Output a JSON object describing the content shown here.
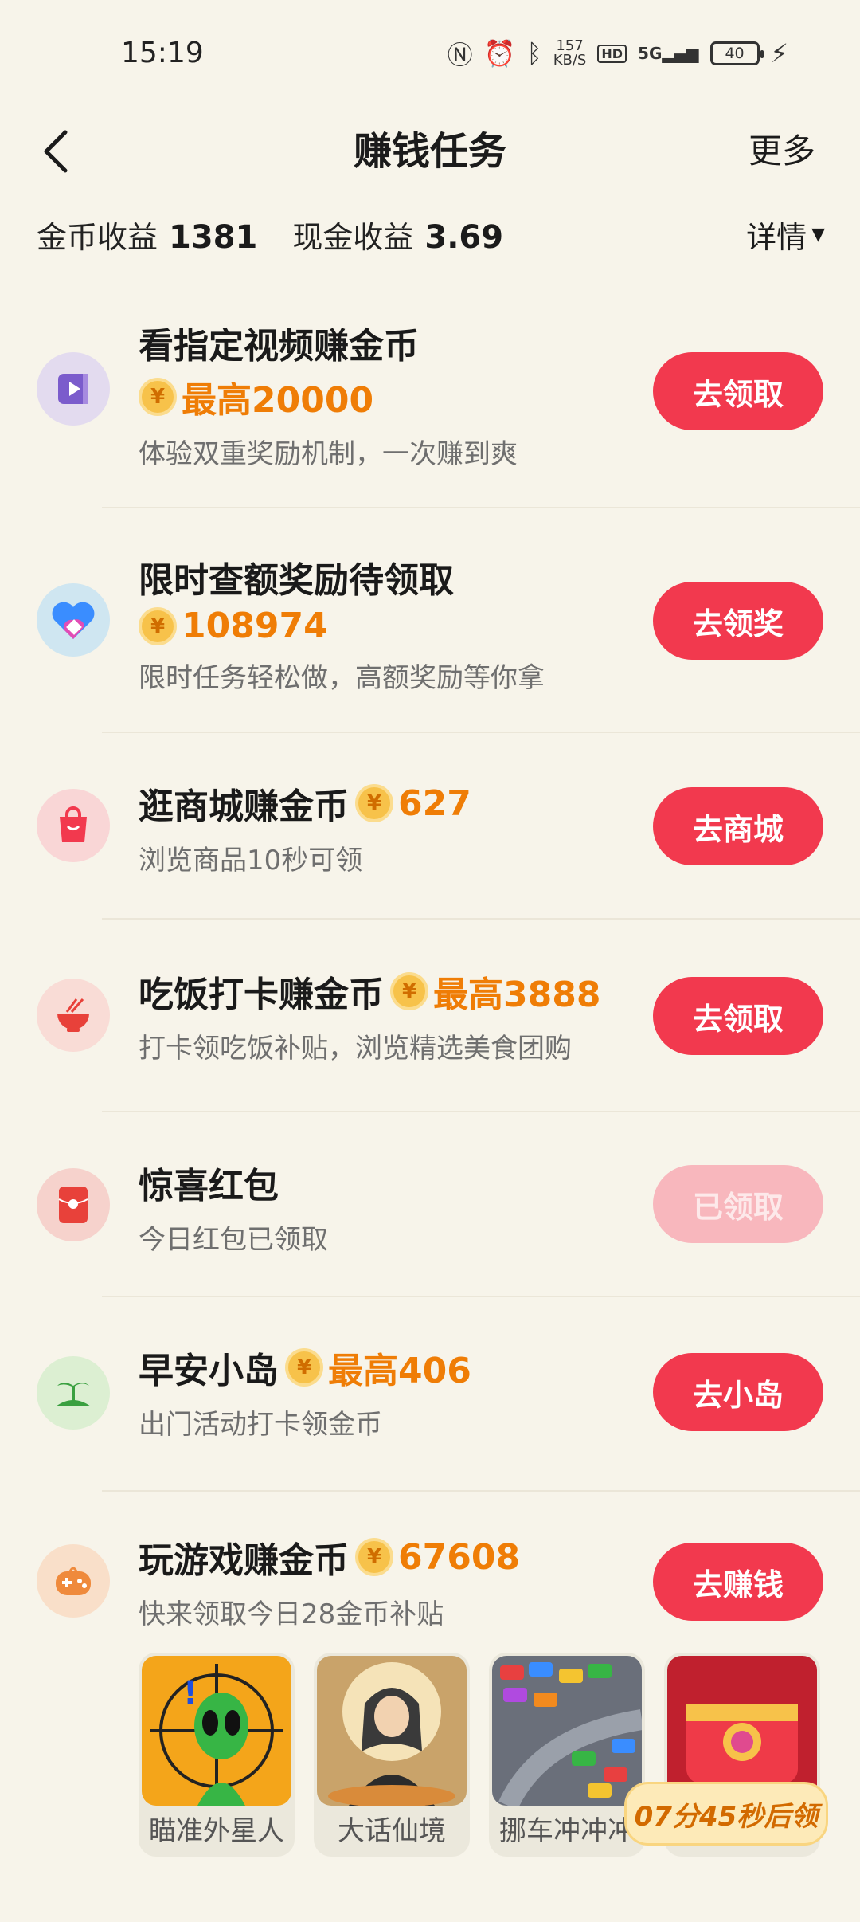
{
  "status": {
    "time": "15:19",
    "net_speed_value": "157",
    "net_speed_unit": "KB/S",
    "hd_label": "HD",
    "signal_label": "5G",
    "battery": "40"
  },
  "header": {
    "title": "赚钱任务",
    "more": "更多"
  },
  "earnings": {
    "coin_label": "金币收益",
    "coin_value": "1381",
    "cash_label": "现金收益",
    "cash_value": "3.69",
    "detail_label": "详情"
  },
  "coin_symbol": "¥",
  "tasks": [
    {
      "title": "看指定视频赚金币",
      "reward": "最高20000",
      "desc": "体验双重奖励机制，一次赚到爽",
      "button": "去领取",
      "icon": "video-icon"
    },
    {
      "title": "限时查额奖励待领取",
      "reward": "108974",
      "desc": "限时任务轻松做，高额奖励等你拿",
      "button": "去领奖",
      "icon": "heart-gem-icon"
    },
    {
      "title": "逛商城赚金币",
      "reward": "627",
      "desc": "浏览商品10秒可领",
      "button": "去商城",
      "icon": "shopping-bag-icon"
    },
    {
      "title": "吃饭打卡赚金币",
      "reward": "最高3888",
      "desc": "打卡领吃饭补贴，浏览精选美食团购",
      "button": "去领取",
      "icon": "rice-bowl-icon"
    },
    {
      "title": "惊喜红包",
      "reward": "",
      "desc": "今日红包已领取",
      "button": "已领取",
      "icon": "red-envelope-icon"
    },
    {
      "title": "早安小岛",
      "reward": "最高406",
      "desc": "出门活动打卡领金币",
      "button": "去小岛",
      "icon": "island-icon"
    },
    {
      "title": "玩游戏赚金币",
      "reward": "67608",
      "desc": "快来领取今日28金币补贴",
      "button": "去赚钱",
      "icon": "gamepad-icon"
    }
  ],
  "games": [
    {
      "name": "瞄准外星人",
      "icon": "alien-target-icon"
    },
    {
      "name": "大话仙境",
      "icon": "immortal-character-icon"
    },
    {
      "name": "挪车冲冲冲",
      "icon": "parking-cars-icon"
    },
    {
      "name": "",
      "icon": "treasure-chest-icon"
    }
  ],
  "timer_badge": "07分45秒后领",
  "colors": {
    "background": "#f7f4ea",
    "primary_button": "#f2394e",
    "disabled_button": "#f8b7bd",
    "coin_text": "#ef7d06"
  }
}
